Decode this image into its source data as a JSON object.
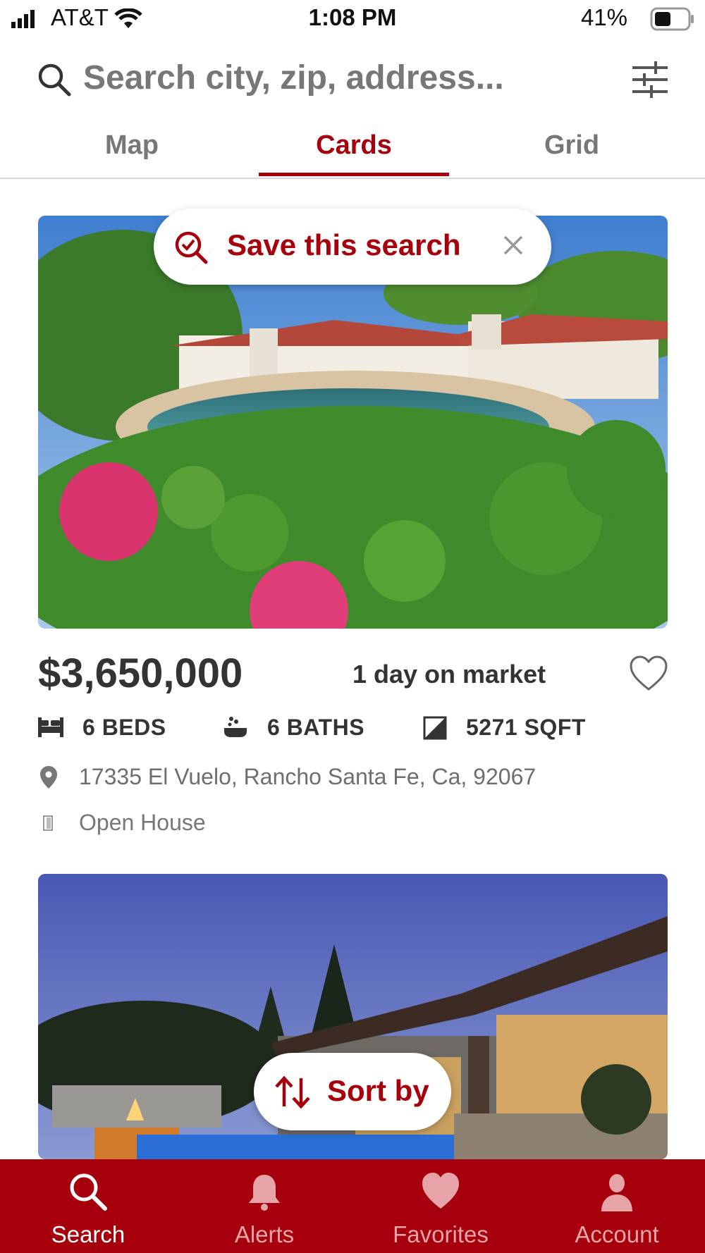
{
  "status_bar": {
    "carrier": "AT&T",
    "time": "1:08 PM",
    "battery": "41%"
  },
  "search": {
    "placeholder": "Search city, zip, address..."
  },
  "tabs": [
    {
      "label": "Map",
      "active": false
    },
    {
      "label": "Cards",
      "active": true
    },
    {
      "label": "Grid",
      "active": false
    }
  ],
  "save_search": {
    "label": "Save this search"
  },
  "listing": {
    "price": "$3,650,000",
    "days_on_market": "1 day on market",
    "beds": "6 BEDS",
    "baths": "6 BATHS",
    "sqft": "5271 SQFT",
    "address": "17335 El Vuelo, Rancho Santa Fe, Ca, 92067",
    "open_house": "Open House"
  },
  "sort": {
    "label": "Sort by"
  },
  "bottom_nav": [
    {
      "label": "Search",
      "icon": "search-icon",
      "active": true
    },
    {
      "label": "Alerts",
      "icon": "bell-icon",
      "active": false
    },
    {
      "label": "Favorites",
      "icon": "heart-icon",
      "active": false
    },
    {
      "label": "Account",
      "icon": "person-icon",
      "active": false
    }
  ],
  "colors": {
    "brand": "#a6000d",
    "text": "#333333",
    "muted": "#777777"
  }
}
